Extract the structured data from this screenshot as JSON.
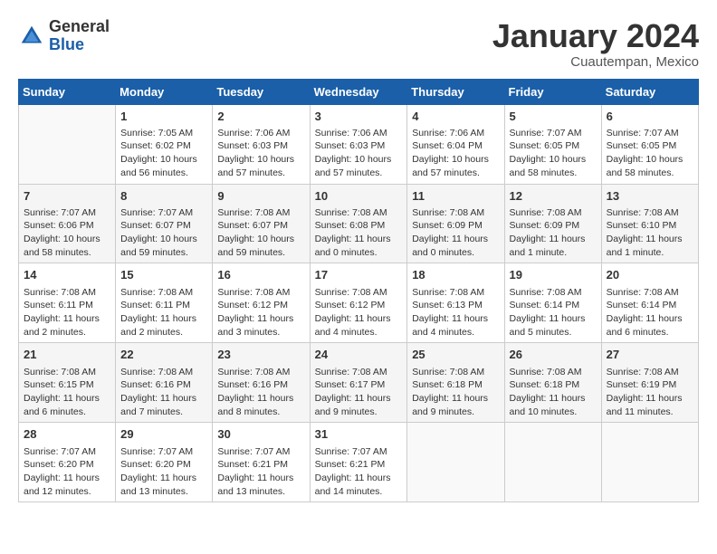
{
  "header": {
    "logo_general": "General",
    "logo_blue": "Blue",
    "month_title": "January 2024",
    "location": "Cuautempan, Mexico"
  },
  "weekdays": [
    "Sunday",
    "Monday",
    "Tuesday",
    "Wednesday",
    "Thursday",
    "Friday",
    "Saturday"
  ],
  "weeks": [
    [
      {
        "day": "",
        "info": ""
      },
      {
        "day": "1",
        "info": "Sunrise: 7:05 AM\nSunset: 6:02 PM\nDaylight: 10 hours\nand 56 minutes."
      },
      {
        "day": "2",
        "info": "Sunrise: 7:06 AM\nSunset: 6:03 PM\nDaylight: 10 hours\nand 57 minutes."
      },
      {
        "day": "3",
        "info": "Sunrise: 7:06 AM\nSunset: 6:03 PM\nDaylight: 10 hours\nand 57 minutes."
      },
      {
        "day": "4",
        "info": "Sunrise: 7:06 AM\nSunset: 6:04 PM\nDaylight: 10 hours\nand 57 minutes."
      },
      {
        "day": "5",
        "info": "Sunrise: 7:07 AM\nSunset: 6:05 PM\nDaylight: 10 hours\nand 58 minutes."
      },
      {
        "day": "6",
        "info": "Sunrise: 7:07 AM\nSunset: 6:05 PM\nDaylight: 10 hours\nand 58 minutes."
      }
    ],
    [
      {
        "day": "7",
        "info": "Sunrise: 7:07 AM\nSunset: 6:06 PM\nDaylight: 10 hours\nand 58 minutes."
      },
      {
        "day": "8",
        "info": "Sunrise: 7:07 AM\nSunset: 6:07 PM\nDaylight: 10 hours\nand 59 minutes."
      },
      {
        "day": "9",
        "info": "Sunrise: 7:08 AM\nSunset: 6:07 PM\nDaylight: 10 hours\nand 59 minutes."
      },
      {
        "day": "10",
        "info": "Sunrise: 7:08 AM\nSunset: 6:08 PM\nDaylight: 11 hours\nand 0 minutes."
      },
      {
        "day": "11",
        "info": "Sunrise: 7:08 AM\nSunset: 6:09 PM\nDaylight: 11 hours\nand 0 minutes."
      },
      {
        "day": "12",
        "info": "Sunrise: 7:08 AM\nSunset: 6:09 PM\nDaylight: 11 hours\nand 1 minute."
      },
      {
        "day": "13",
        "info": "Sunrise: 7:08 AM\nSunset: 6:10 PM\nDaylight: 11 hours\nand 1 minute."
      }
    ],
    [
      {
        "day": "14",
        "info": "Sunrise: 7:08 AM\nSunset: 6:11 PM\nDaylight: 11 hours\nand 2 minutes."
      },
      {
        "day": "15",
        "info": "Sunrise: 7:08 AM\nSunset: 6:11 PM\nDaylight: 11 hours\nand 2 minutes."
      },
      {
        "day": "16",
        "info": "Sunrise: 7:08 AM\nSunset: 6:12 PM\nDaylight: 11 hours\nand 3 minutes."
      },
      {
        "day": "17",
        "info": "Sunrise: 7:08 AM\nSunset: 6:12 PM\nDaylight: 11 hours\nand 4 minutes."
      },
      {
        "day": "18",
        "info": "Sunrise: 7:08 AM\nSunset: 6:13 PM\nDaylight: 11 hours\nand 4 minutes."
      },
      {
        "day": "19",
        "info": "Sunrise: 7:08 AM\nSunset: 6:14 PM\nDaylight: 11 hours\nand 5 minutes."
      },
      {
        "day": "20",
        "info": "Sunrise: 7:08 AM\nSunset: 6:14 PM\nDaylight: 11 hours\nand 6 minutes."
      }
    ],
    [
      {
        "day": "21",
        "info": "Sunrise: 7:08 AM\nSunset: 6:15 PM\nDaylight: 11 hours\nand 6 minutes."
      },
      {
        "day": "22",
        "info": "Sunrise: 7:08 AM\nSunset: 6:16 PM\nDaylight: 11 hours\nand 7 minutes."
      },
      {
        "day": "23",
        "info": "Sunrise: 7:08 AM\nSunset: 6:16 PM\nDaylight: 11 hours\nand 8 minutes."
      },
      {
        "day": "24",
        "info": "Sunrise: 7:08 AM\nSunset: 6:17 PM\nDaylight: 11 hours\nand 9 minutes."
      },
      {
        "day": "25",
        "info": "Sunrise: 7:08 AM\nSunset: 6:18 PM\nDaylight: 11 hours\nand 9 minutes."
      },
      {
        "day": "26",
        "info": "Sunrise: 7:08 AM\nSunset: 6:18 PM\nDaylight: 11 hours\nand 10 minutes."
      },
      {
        "day": "27",
        "info": "Sunrise: 7:08 AM\nSunset: 6:19 PM\nDaylight: 11 hours\nand 11 minutes."
      }
    ],
    [
      {
        "day": "28",
        "info": "Sunrise: 7:07 AM\nSunset: 6:20 PM\nDaylight: 11 hours\nand 12 minutes."
      },
      {
        "day": "29",
        "info": "Sunrise: 7:07 AM\nSunset: 6:20 PM\nDaylight: 11 hours\nand 13 minutes."
      },
      {
        "day": "30",
        "info": "Sunrise: 7:07 AM\nSunset: 6:21 PM\nDaylight: 11 hours\nand 13 minutes."
      },
      {
        "day": "31",
        "info": "Sunrise: 7:07 AM\nSunset: 6:21 PM\nDaylight: 11 hours\nand 14 minutes."
      },
      {
        "day": "",
        "info": ""
      },
      {
        "day": "",
        "info": ""
      },
      {
        "day": "",
        "info": ""
      }
    ]
  ]
}
